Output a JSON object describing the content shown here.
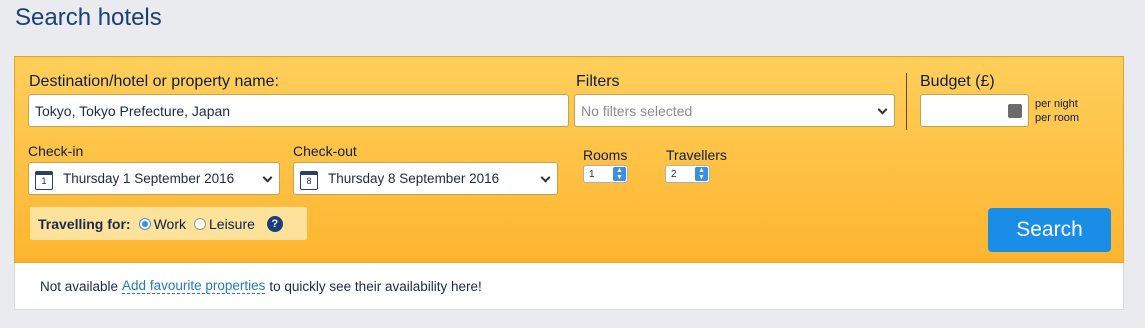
{
  "page": {
    "title": "Search hotels"
  },
  "destination": {
    "label": "Destination/hotel or property name:",
    "value": "Tokyo, Tokyo Prefecture, Japan"
  },
  "filters": {
    "label": "Filters",
    "placeholder": "No filters selected"
  },
  "budget": {
    "label": "Budget (£)",
    "note_line1": "per night",
    "note_line2": "per room",
    "value": "",
    "icon": "calculator-icon"
  },
  "checkin": {
    "label": "Check-in",
    "icon_day": "1",
    "value": "Thursday 1 September 2016"
  },
  "checkout": {
    "label": "Check-out",
    "icon_day": "8",
    "value": "Thursday 8 September 2016"
  },
  "rooms": {
    "label": "Rooms",
    "value": "1"
  },
  "travellers": {
    "label": "Travellers",
    "value": "2"
  },
  "travelling_for": {
    "label": "Travelling for:",
    "options": [
      "Work",
      "Leisure"
    ],
    "selected": "Work",
    "help_icon": "question-icon"
  },
  "search_button": {
    "label": "Search"
  },
  "favourites": {
    "prefix": "Not available",
    "link": "Add favourite properties",
    "suffix": "to quickly see their availability here!"
  },
  "colors": {
    "panel": "#fdb52f",
    "accent": "#1a8ee6",
    "title": "#1a3f7a"
  }
}
